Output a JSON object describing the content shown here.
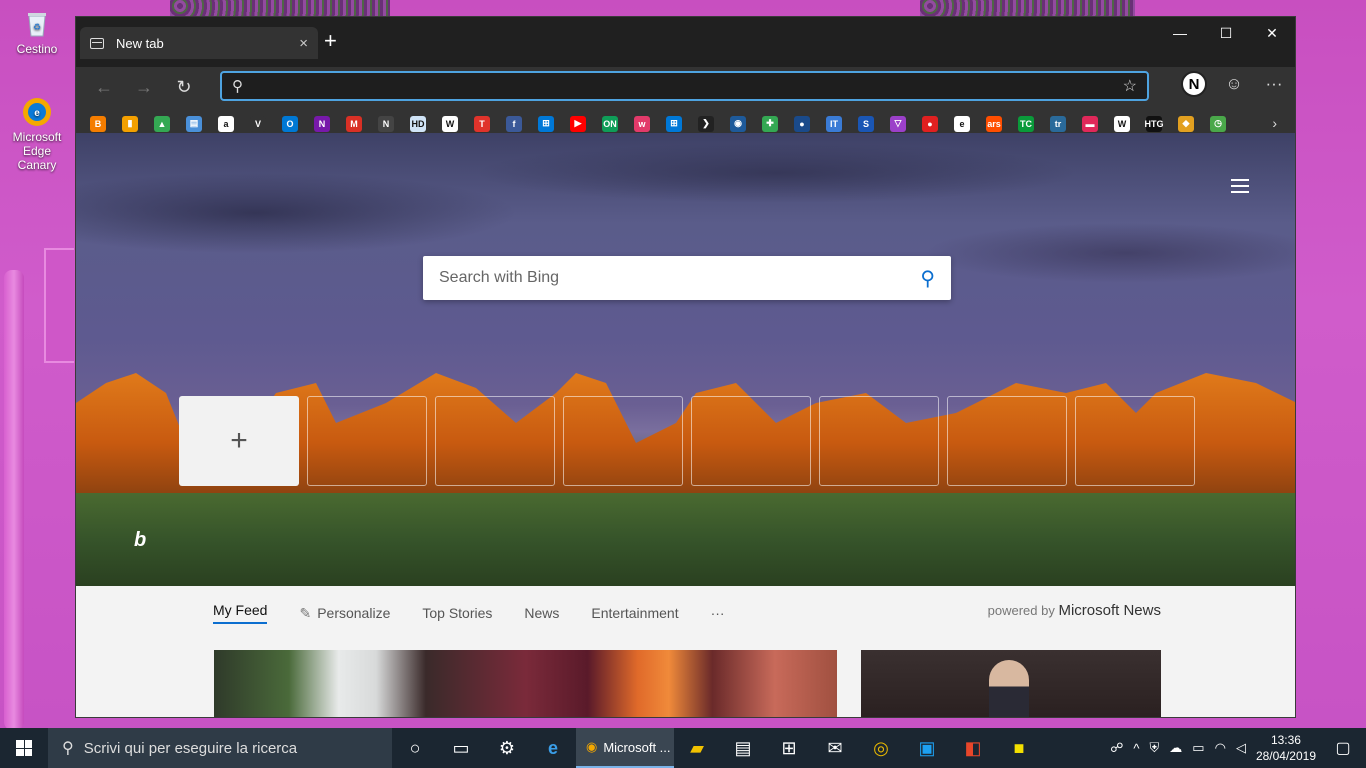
{
  "desktop": {
    "icons": [
      {
        "label": "Cestino"
      },
      {
        "label": "Microsoft Edge Canary"
      }
    ]
  },
  "browser": {
    "tab_title": "New tab",
    "tab_close": "×",
    "new_tab": "+",
    "window_controls": {
      "minimize": "—",
      "maximize": "☐",
      "close": "✕"
    },
    "address": {
      "value": "",
      "placeholder": ""
    },
    "profile_initial": "N",
    "more_label": "···",
    "favorites_more": "›",
    "favorites": [
      {
        "icon": "blogger-icon",
        "color": "#f57d00",
        "text": "B"
      },
      {
        "icon": "analytics-icon",
        "color": "#f4a000",
        "text": "▮"
      },
      {
        "icon": "drive-icon",
        "color": "#34a853",
        "text": "▲"
      },
      {
        "icon": "store-icon",
        "color": "#4a90d9",
        "text": "▤"
      },
      {
        "icon": "amazon-icon",
        "color": "#ffffff",
        "text": "a"
      },
      {
        "icon": "v-icon",
        "color": "#333333",
        "text": "V"
      },
      {
        "icon": "outlook-icon",
        "color": "#0078d4",
        "text": "O"
      },
      {
        "icon": "onenote-icon",
        "color": "#7719aa",
        "text": "N"
      },
      {
        "icon": "gmail-icon",
        "color": "#d93025",
        "text": "M"
      },
      {
        "icon": "n-icon",
        "color": "#444444",
        "text": "N"
      },
      {
        "icon": "hd-icon",
        "color": "#d0e4f7",
        "text": "HD"
      },
      {
        "icon": "w-icon",
        "color": "#ffffff",
        "text": "W"
      },
      {
        "icon": "t-icon",
        "color": "#e0332b",
        "text": "T"
      },
      {
        "icon": "facebook-icon",
        "color": "#3b5998",
        "text": "f"
      },
      {
        "icon": "windows-icon",
        "color": "#0078d7",
        "text": "⊞"
      },
      {
        "icon": "youtube-icon",
        "color": "#ff0000",
        "text": "▶"
      },
      {
        "icon": "on-icon",
        "color": "#0f9d58",
        "text": "ON"
      },
      {
        "icon": "w2-icon",
        "color": "#e23a6a",
        "text": "w"
      },
      {
        "icon": "windows2-icon",
        "color": "#0078d7",
        "text": "⊞"
      },
      {
        "icon": "arrow-icon",
        "color": "#222222",
        "text": "❯"
      },
      {
        "icon": "globe-icon",
        "color": "#1e5a9a",
        "text": "◉"
      },
      {
        "icon": "plus-color-icon",
        "color": "#34a853",
        "text": "✚"
      },
      {
        "icon": "circle-icon",
        "color": "#1a4a8a",
        "text": "●"
      },
      {
        "icon": "itpro-icon",
        "color": "#3a7bd5",
        "text": "IT"
      },
      {
        "icon": "s-icon",
        "color": "#1a56b4",
        "text": "S"
      },
      {
        "icon": "triangle-icon",
        "color": "#9b40c9",
        "text": "▽"
      },
      {
        "icon": "red-circle-icon",
        "color": "#e02020",
        "text": "●"
      },
      {
        "icon": "e-icon",
        "color": "#ffffff",
        "text": "e"
      },
      {
        "icon": "ars-icon",
        "color": "#ff4e00",
        "text": "ars"
      },
      {
        "icon": "tc-icon",
        "color": "#0a9a3a",
        "text": "TC"
      },
      {
        "icon": "tr-icon",
        "color": "#2a6a9a",
        "text": "tr"
      },
      {
        "icon": "pink-icon",
        "color": "#e0285a",
        "text": "▬"
      },
      {
        "icon": "w3-icon",
        "color": "#ffffff",
        "text": "W"
      },
      {
        "icon": "htg-icon",
        "color": "#111111",
        "text": "HTG"
      },
      {
        "icon": "cube-icon",
        "color": "#e2a020",
        "text": "◆"
      },
      {
        "icon": "clock-icon",
        "color": "#4aa84a",
        "text": "◷"
      }
    ]
  },
  "newtab": {
    "search_placeholder": "Search with Bing",
    "add_tile": "+",
    "bing_logo": "b"
  },
  "feed": {
    "tabs": [
      "My Feed",
      "Personalize",
      "Top Stories",
      "News",
      "Entertainment",
      "···"
    ],
    "powered_prefix": "powered by",
    "powered_brand": "Microsoft News"
  },
  "taskbar": {
    "search_placeholder": "Scrivi qui per eseguire la ricerca",
    "active_app": "Microsoft ...",
    "time": "13:36",
    "date": "28/04/2019"
  }
}
